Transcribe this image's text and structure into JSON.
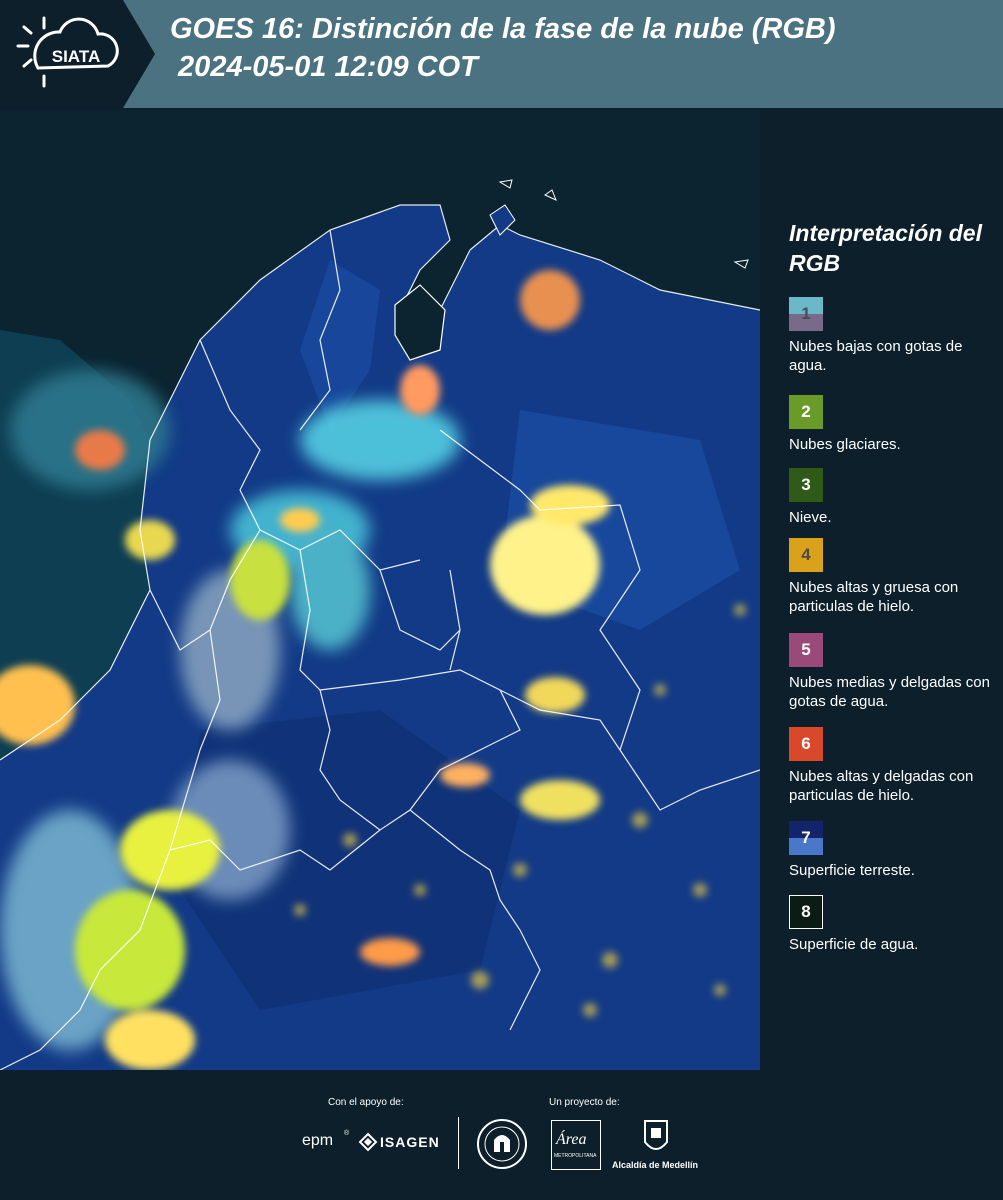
{
  "header": {
    "logo_text": "SIATA",
    "title_line1": "GOES 16: Distinción de la fase de la nube (RGB)",
    "title_line2": " 2024-05-01 12:09 COT"
  },
  "legend": {
    "title": "Interpretación del RGB",
    "items": [
      {
        "number": "1",
        "label": "Nubes bajas con gotas de agua.",
        "color_top": "#6bb8c8",
        "color_bottom": "#7a6a8a"
      },
      {
        "number": "2",
        "label": "Nubes glaciares.",
        "color_top": "#6a9a28"
      },
      {
        "number": "3",
        "label": "Nieve.",
        "color_top": "#2f5a18"
      },
      {
        "number": "4",
        "label": "Nubes altas y gruesa con particulas de hielo.",
        "color_top": "#d9a21a"
      },
      {
        "number": "5",
        "label": "Nubes medias y delgadas con gotas de agua.",
        "color_top": "#9a4a78"
      },
      {
        "number": "6",
        "label": "Nubes altas y delgadas con particulas de hielo.",
        "color_top": "#d9482a"
      },
      {
        "number": "7",
        "label": "Superficie terreste.",
        "color_top": "#14246a",
        "color_bottom": "#4a78c8"
      },
      {
        "number": "8",
        "label": "Superficie de agua.",
        "color_top": "#0a1c14"
      }
    ]
  },
  "footer": {
    "support_caption": "Con el apoyo de:",
    "project_caption": "Un proyecto de:",
    "sponsor_1": "epm",
    "sponsor_2": "ISAGEN",
    "partner_area": "Área",
    "partner_area_sub": "METROPOLITANA",
    "partner_alcaldia": "Alcaldía de Medellín"
  },
  "colors": {
    "header_bg": "#4b7281",
    "logo_bg": "#0c1f2a",
    "page_bg": "#0c1f2a",
    "map_ocean": "#0e2a33",
    "map_land": "#123c8a"
  }
}
